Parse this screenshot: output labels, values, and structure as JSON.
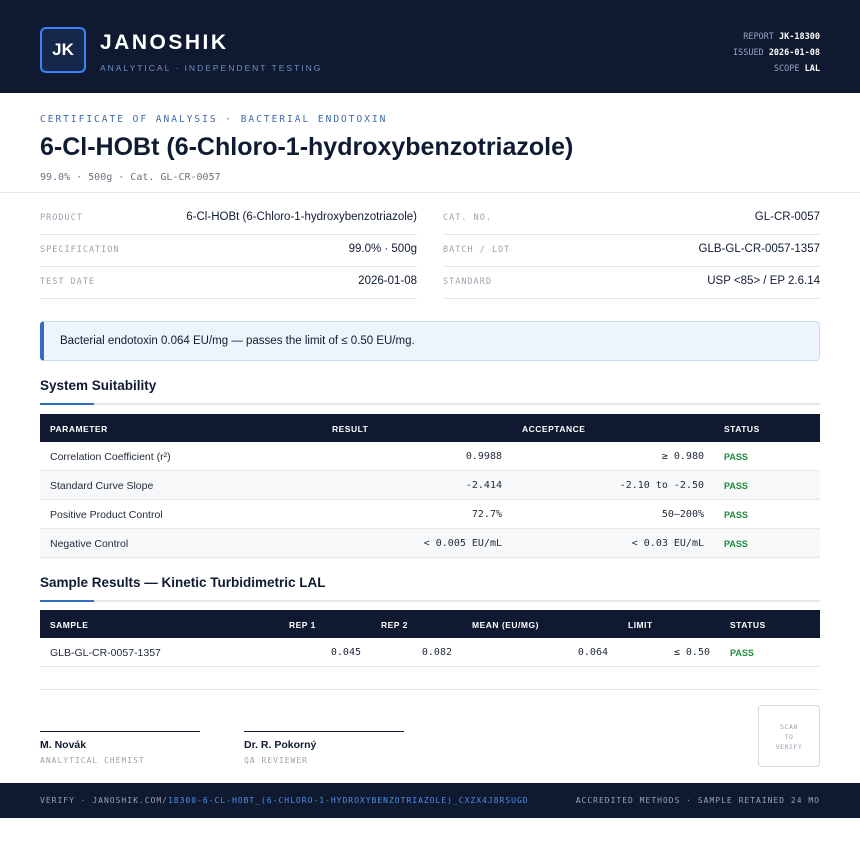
{
  "header": {
    "logo_initials": "JK",
    "brand": "JANOSHIK",
    "tagline": "ANALYTICAL · INDEPENDENT TESTING",
    "report_label": "REPORT",
    "report_value": "JK-18300",
    "issued_label": "ISSUED",
    "issued_value": "2026-01-08",
    "scope_label": "SCOPE",
    "scope_value": "LAL"
  },
  "title_block": {
    "eyebrow": "CERTIFICATE OF ANALYSIS · BACTERIAL ENDOTOXIN",
    "title": "6-Cl-HOBt (6-Chloro-1-hydroxybenzotriazole)",
    "subline": "99.0% · 500g  ·  Cat. GL-CR-0057"
  },
  "info": {
    "product_label": "PRODUCT",
    "product_value": "6-Cl-HOBt (6-Chloro-1-hydroxybenzotriazole)",
    "spec_label": "SPECIFICATION",
    "spec_value": "99.0% · 500g",
    "date_label": "TEST DATE",
    "date_value": "2026-01-08",
    "cat_label": "CAT. NO.",
    "cat_value": "GL-CR-0057",
    "batch_label": "BATCH / LOT",
    "batch_value": "GLB-GL-CR-0057-1357",
    "standard_label": "STANDARD",
    "standard_value": "USP <85> / EP 2.6.14"
  },
  "callout": "Bacterial endotoxin 0.064 EU/mg — passes the limit of ≤ 0.50 EU/mg.",
  "suitability": {
    "title": "System Suitability",
    "headers": [
      "PARAMETER",
      "RESULT",
      "ACCEPTANCE",
      "STATUS"
    ],
    "rows": [
      {
        "parameter": "Correlation Coefficient (r²)",
        "result": "0.9988",
        "acceptance": "≥ 0.980",
        "status": "PASS"
      },
      {
        "parameter": "Standard Curve Slope",
        "result": "-2.414",
        "acceptance": "-2.10 to -2.50",
        "status": "PASS"
      },
      {
        "parameter": "Positive Product Control",
        "result": "72.7%",
        "acceptance": "50–200%",
        "status": "PASS"
      },
      {
        "parameter": "Negative Control",
        "result": "< 0.005 EU/mL",
        "acceptance": "< 0.03 EU/mL",
        "status": "PASS"
      }
    ]
  },
  "samples": {
    "title": "Sample Results — Kinetic Turbidimetric LAL",
    "headers": [
      "SAMPLE",
      "REP 1",
      "REP 2",
      "MEAN (EU/MG)",
      "LIMIT",
      "STATUS"
    ],
    "rows": [
      {
        "sample": "GLB-GL-CR-0057-1357",
        "rep1": "0.045",
        "rep2": "0.082",
        "mean": "0.064",
        "limit": "≤ 0.50",
        "status": "PASS"
      }
    ]
  },
  "signatures": [
    {
      "name": "M. Novák",
      "role": "ANALYTICAL CHEMIST"
    },
    {
      "name": "Dr. R. Pokorný",
      "role": "QA REVIEWER"
    }
  ],
  "qr": {
    "line1": "SCAN",
    "line2": "TO",
    "line3": "VERIFY"
  },
  "footer": {
    "verify_prefix": "VERIFY · JANOSHIK.COM/",
    "verify_path": "18300-6-CL-HOBT_(6-CHLORO-1-HYDROXYBENZOTRIAZOLE)_CXZX4J8RSUGD",
    "right": "ACCREDITED METHODS · SAMPLE RETAINED 24 MO"
  },
  "colors": {
    "navy": "#0f1a31",
    "accent_blue": "#2f6fbf",
    "pass_green": "#1f8a3b"
  }
}
